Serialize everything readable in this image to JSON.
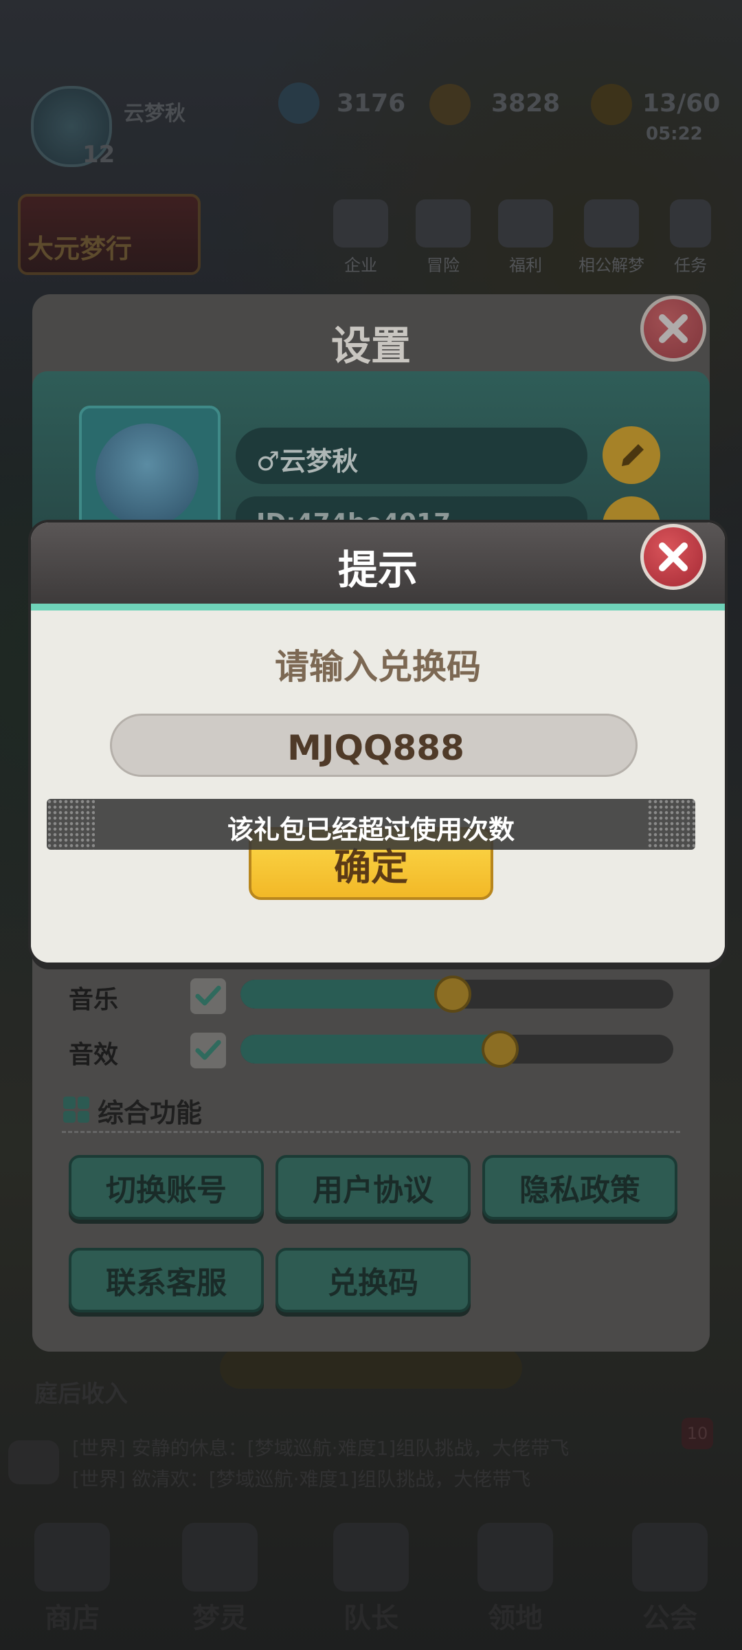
{
  "hud": {
    "player_name": "云梦秋",
    "player_level": "12",
    "resource_1": "3176",
    "resource_2": "3828",
    "stamina": "13/60",
    "timer": "05:22",
    "banner_text": "大元梦行",
    "features": [
      {
        "label": "企业",
        "icon": "gift-icon"
      },
      {
        "label": "冒险",
        "icon": "adventure-icon"
      },
      {
        "label": "福利",
        "icon": "welfare-icon"
      },
      {
        "label": "相公解梦",
        "icon": "dream-icon"
      },
      {
        "label": "任务",
        "icon": "task-icon"
      }
    ]
  },
  "settings": {
    "title": "设置",
    "name": "♂云梦秋",
    "id_text": "ID:474be4017",
    "music_label": "音乐",
    "music_level": 0.49,
    "sfx_label": "音效",
    "sfx_level": 0.6,
    "section_title": "综合功能",
    "buttons": [
      "切换账号",
      "用户协议",
      "隐私政策",
      "联系客服",
      "兑换码"
    ]
  },
  "below": {
    "income_label": "庭后收入",
    "chat": [
      "[世界] 安静的休息：[梦域巡航·难度1]组队挑战，大佬带飞",
      "[世界] 欲清欢：[梦域巡航·难度1]组队挑战，大佬带飞"
    ],
    "chat_badge": "10",
    "nav": [
      "商店",
      "梦灵",
      "队长",
      "领地",
      "公会"
    ]
  },
  "dialog": {
    "title": "提示",
    "prompt": "请输入兑换码",
    "code_value": "MJQQ888",
    "confirm_label": "确定"
  },
  "toast": {
    "message": "该礼包已经超过使用次数"
  },
  "colors": {
    "accent_green": "#6fd3b9",
    "confirm_yellow": "#f2b827",
    "close_red": "#c23b46"
  }
}
